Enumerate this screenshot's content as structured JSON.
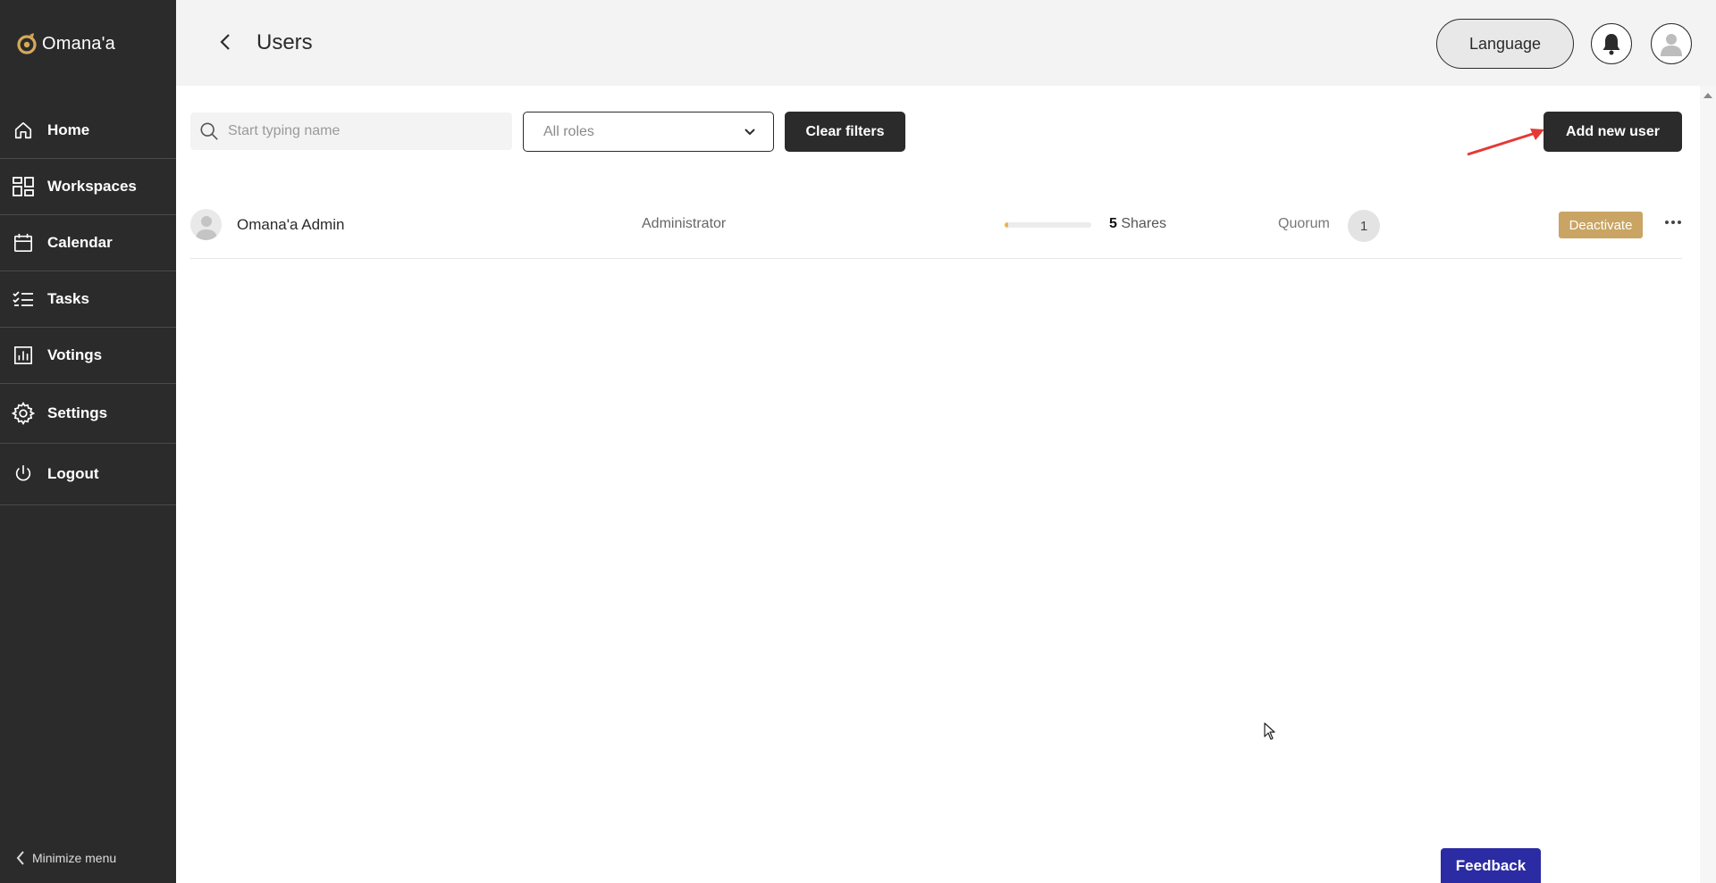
{
  "app": {
    "name": "Omana'a",
    "brand_color": "#c9a463"
  },
  "sidebar": {
    "items": [
      {
        "label": "Home",
        "icon": "home-icon"
      },
      {
        "label": "Workspaces",
        "icon": "grid-icon"
      },
      {
        "label": "Calendar",
        "icon": "calendar-icon"
      },
      {
        "label": "Tasks",
        "icon": "tasks-icon"
      },
      {
        "label": "Votings",
        "icon": "chart-icon"
      },
      {
        "label": "Settings",
        "icon": "gear-icon"
      },
      {
        "label": "Logout",
        "icon": "power-icon"
      }
    ],
    "minimize_label": "Minimize menu"
  },
  "header": {
    "title": "Users",
    "language_label": "Language"
  },
  "filters": {
    "search_placeholder": "Start typing name",
    "roles_value": "All roles",
    "clear_label": "Clear filters",
    "add_label": "Add new user"
  },
  "users": [
    {
      "name": "Omana'a Admin",
      "role": "Administrator",
      "shares_count": "5",
      "shares_label": "Shares",
      "shares_progress": 0.04,
      "quorum_label": "Quorum",
      "quorum_value": "1",
      "action_label": "Deactivate"
    }
  ],
  "feedback_label": "Feedback"
}
